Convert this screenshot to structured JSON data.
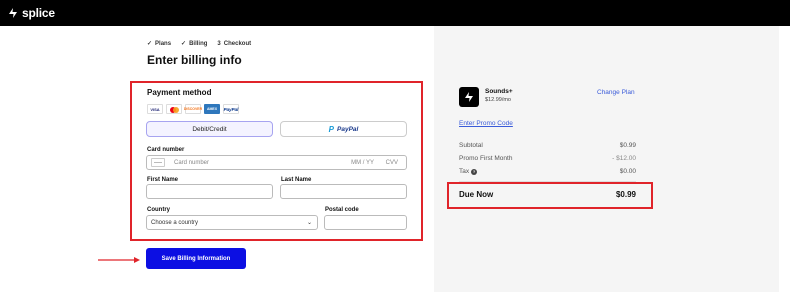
{
  "brand": {
    "name": "splice"
  },
  "steps": [
    {
      "label": "Plans",
      "marker": "✓"
    },
    {
      "label": "Billing",
      "marker": "✓"
    },
    {
      "label": "Checkout",
      "marker": "3"
    }
  ],
  "page_title": "Enter billing info",
  "payment": {
    "title": "Payment method",
    "card_logos": [
      "VISA",
      "mastercard",
      "DISCOVER",
      "AMEX",
      "PayPal"
    ],
    "tab_debit": "Debit/Credit",
    "tab_paypal": "PayPal",
    "card_number_label": "Card number",
    "card_number_placeholder": "Card number",
    "expiry_placeholder": "MM / YY",
    "cvv_placeholder": "CVV",
    "first_name_label": "First Name",
    "last_name_label": "Last Name",
    "country_label": "Country",
    "country_value": "Choose a country",
    "postal_label": "Postal code"
  },
  "save_button": "Save Billing Information",
  "summary": {
    "product_name": "Sounds+",
    "product_price": "$12.99/mo",
    "change_plan": "Change Plan",
    "promo_link": "Enter Promo Code",
    "rows": [
      {
        "label": "Subtotal",
        "value": "$0.99"
      },
      {
        "label": "Promo First Month",
        "value": "- $12.00"
      },
      {
        "label": "Tax",
        "value": "$0.00"
      }
    ],
    "due_label": "Due Now",
    "due_value": "$0.99"
  },
  "colors": {
    "accent": "#0c0fe3",
    "highlight": "#e0242a",
    "link": "#3a5bd9"
  }
}
